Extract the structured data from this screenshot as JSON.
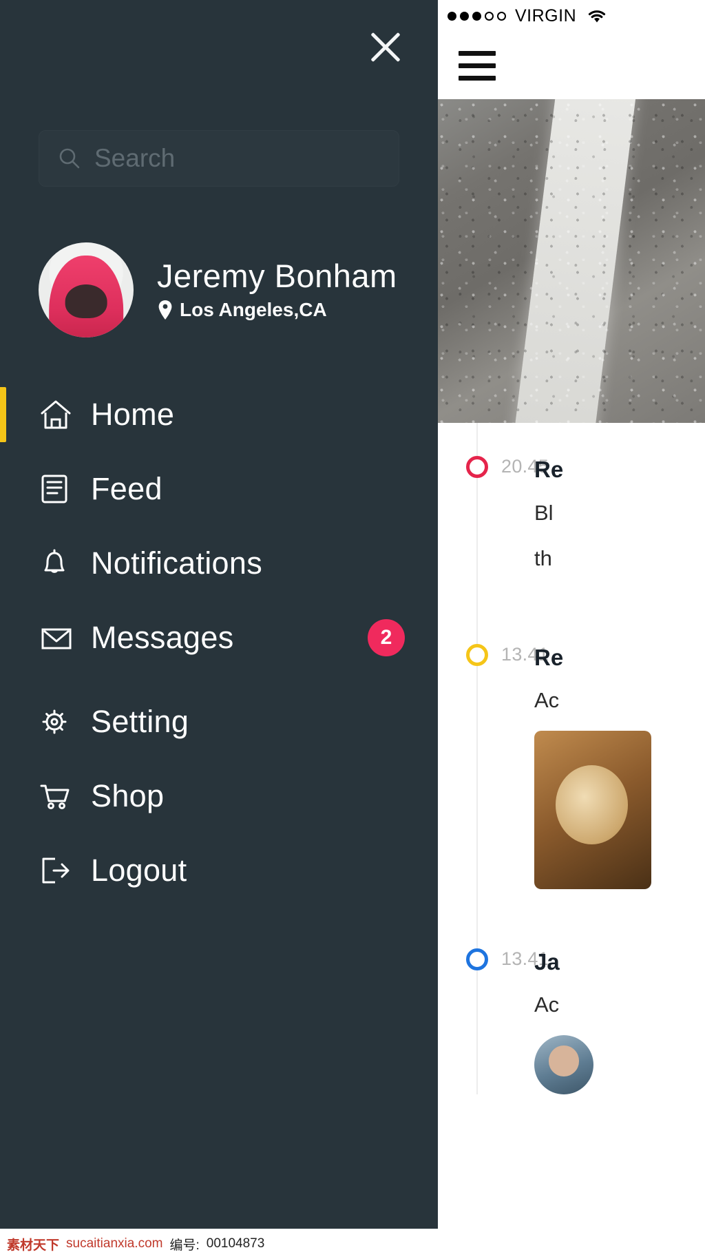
{
  "drawer": {
    "close_icon": "close-icon",
    "search": {
      "placeholder": "Search",
      "value": "",
      "icon": "search-icon"
    },
    "profile": {
      "name": "Jeremy Bonham",
      "location": "Los Angeles,CA",
      "location_icon": "map-pin-icon",
      "avatar_icon": "avatar"
    },
    "nav_items": [
      {
        "label": "Home",
        "icon": "home-icon",
        "active": true,
        "badge": ""
      },
      {
        "label": "Feed",
        "icon": "feed-icon",
        "active": false,
        "badge": ""
      },
      {
        "label": "Notifications",
        "icon": "bell-icon",
        "active": false,
        "badge": ""
      },
      {
        "label": "Messages",
        "icon": "envelope-icon",
        "active": false,
        "badge": "2"
      },
      {
        "label": "Setting",
        "icon": "gear-icon",
        "active": false,
        "badge": ""
      },
      {
        "label": "Shop",
        "icon": "shopping-cart-icon",
        "active": false,
        "badge": ""
      },
      {
        "label": "Logout",
        "icon": "logout-icon",
        "active": false,
        "badge": ""
      }
    ]
  },
  "app_screen": {
    "status_bar": {
      "signal_filled": 3,
      "signal_empty": 2,
      "carrier": "VIRGIN",
      "wifi_icon": "wifi-icon"
    },
    "menu_icon": "hamburger-icon",
    "hero_image": "road-marking-photo",
    "timeline": [
      {
        "time": "20.45",
        "title": "Re",
        "text": "Bl\nth",
        "marker_color": "#e5244b",
        "thumb": "",
        "avatar": ""
      },
      {
        "time": "13.41",
        "title": "Re",
        "text": "Ac",
        "marker_color": "#f5c518",
        "thumb": "food-photo",
        "avatar": ""
      },
      {
        "time": "13.41",
        "title": "Ja",
        "text": "Ac",
        "marker_color": "#1e74df",
        "thumb": "",
        "avatar": "person-avatar"
      }
    ]
  },
  "colors": {
    "drawer_bg": "#28343b",
    "accent_yellow": "#f5c518",
    "badge_pink": "#f02a5d",
    "marker_red": "#e5244b",
    "marker_blue": "#1e74df"
  },
  "watermark": {
    "brand": "素材天下",
    "site": "sucaitianxia.com",
    "label": "编号:",
    "id": "00104873"
  }
}
